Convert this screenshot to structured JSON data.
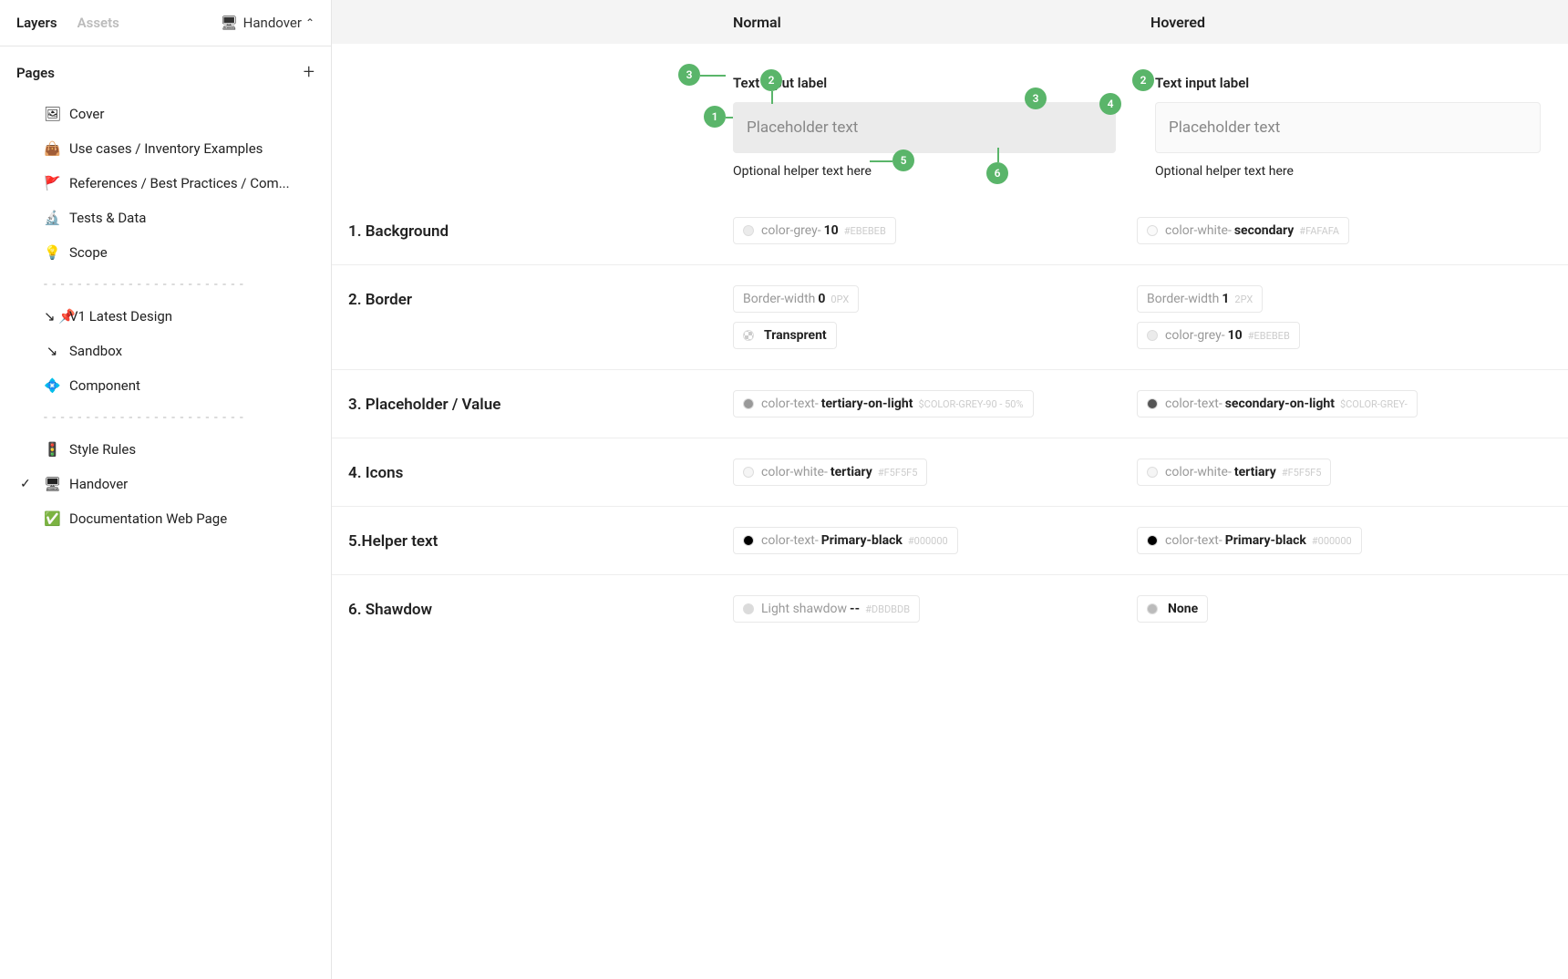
{
  "sidebar": {
    "tabs": [
      {
        "label": "Layers",
        "active": true
      },
      {
        "label": "Assets",
        "active": false
      }
    ],
    "filename": {
      "icon": "🖥",
      "name": "Handover"
    },
    "pagesTitle": "Pages",
    "pages": [
      {
        "emoji": "🖼",
        "label": "Cover"
      },
      {
        "emoji": "👜",
        "label": "Use cases / Inventory Examples"
      },
      {
        "emoji": "🚩",
        "label": "References  / Best Practices / Com..."
      },
      {
        "emoji": "🔬",
        "label": "Tests & Data"
      },
      {
        "emoji": "💡",
        "label": "Scope"
      },
      {
        "divider": "- - - - - - - - - - - - - - - - - - - - - - - -"
      },
      {
        "emoji": "↘ 📌",
        "label": "V1  Latest Design"
      },
      {
        "emoji": "↘",
        "label": "Sandbox"
      },
      {
        "emoji": "💠",
        "label": "Component"
      },
      {
        "divider": "- - - - - - - - - - - - - - - - - - - - - - - -"
      },
      {
        "emoji": "🚦",
        "label": "Style Rules"
      },
      {
        "emoji": "🖥",
        "label": "Handover",
        "selected": true
      },
      {
        "emoji": "✅",
        "label": "Documentation Web Page"
      }
    ]
  },
  "canvas": {
    "stateHeaders": [
      "Normal",
      "Hovered"
    ],
    "preview": {
      "label": "Text input label",
      "placeholder": "Placeholder text",
      "helper": "Optional helper text here",
      "annotations": [
        "1",
        "2",
        "3",
        "4",
        "5",
        "6"
      ]
    },
    "specs": [
      {
        "label": "1. Background",
        "normal": [
          {
            "swatch": "#EBEBEB",
            "prefix": "color-grey-",
            "name": "10",
            "meta": "#EBEBEB"
          }
        ],
        "hovered": [
          {
            "swatch": "#FAFAFA",
            "prefix": "color-white-",
            "name": "secondary",
            "meta": "#FAFAFA"
          }
        ]
      },
      {
        "label": "2. Border",
        "normal": [
          {
            "swatch": null,
            "prefix": "Border-width ",
            "name": "0",
            "meta": "0px"
          },
          {
            "swatch": "transparent",
            "prefix": "",
            "name": "Transprent",
            "meta": ""
          }
        ],
        "hovered": [
          {
            "swatch": null,
            "prefix": "Border-width ",
            "name": "1",
            "meta": "2px"
          },
          {
            "swatch": "#EBEBEB",
            "prefix": "color-grey-",
            "name": "10",
            "meta": "#EBEBEB"
          }
        ]
      },
      {
        "label": "3. Placeholder / Value",
        "normal": [
          {
            "swatch": "#999999",
            "prefix": "color-text-",
            "name": "tertiary-on-light",
            "meta": "$COLOR-GREY-90 - 50%"
          }
        ],
        "hovered": [
          {
            "swatch": "#555555",
            "prefix": "color-text-",
            "name": "secondary-on-light",
            "meta": "$COLOR-GREY-"
          }
        ]
      },
      {
        "label": "4. Icons",
        "normal": [
          {
            "swatch": "#F5F5F5",
            "prefix": "color-white-",
            "name": "tertiary",
            "meta": "#F5F5F5"
          }
        ],
        "hovered": [
          {
            "swatch": "#F5F5F5",
            "prefix": "color-white-",
            "name": "tertiary",
            "meta": "#F5F5F5"
          }
        ]
      },
      {
        "label": "5.Helper text",
        "normal": [
          {
            "swatch": "#000000",
            "prefix": "color-text-",
            "name": "Primary-black",
            "meta": "#000000"
          }
        ],
        "hovered": [
          {
            "swatch": "#000000",
            "prefix": "color-text-",
            "name": "Primary-black",
            "meta": "#000000"
          }
        ]
      },
      {
        "label": "6. Shawdow",
        "normal": [
          {
            "swatch": "#DBDBDB",
            "prefix": "Light shawdow ",
            "name": "--",
            "meta": "#DBDBDB"
          }
        ],
        "hovered": [
          {
            "swatch": "#BBBBBB",
            "prefix": "",
            "name": "None",
            "meta": ""
          }
        ]
      }
    ]
  }
}
